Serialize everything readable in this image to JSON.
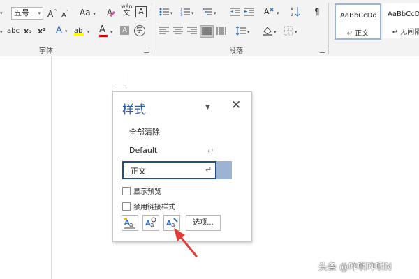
{
  "ribbon": {
    "font_group_label": "字体",
    "para_group_label": "段落",
    "font_size_value": "五号",
    "grow_font_label": "A",
    "shrink_font_label": "A",
    "change_case_label": "Aa",
    "phonetic_label": "wén",
    "border_char_label": "A",
    "strike_label": "abc",
    "subscript_label": "x₂",
    "superscript_label": "x²",
    "text_effect_label": "A",
    "font_color_label": "A",
    "char_shading_label": "A",
    "enclose_char_label": "字",
    "style_gallery": [
      {
        "sample": "AaBbCcDd",
        "name": "↵ 正文",
        "active": true
      },
      {
        "sample": "AaBbCcDc",
        "name": "↵ 无间隔",
        "active": false
      }
    ]
  },
  "styles_pane": {
    "title": "样式",
    "clear_all": "全部清除",
    "default_style": "Default",
    "current_style": "正文",
    "para_mark": "↵",
    "show_preview_label": "显示预览",
    "disable_linked_label": "禁用链接样式",
    "options_button_label": "选项..."
  },
  "watermark": "头条 @咋啊咋啊N",
  "colors": {
    "title_blue": "#2e5ea8",
    "selected_border": "#234f8e",
    "selected_side": "#9db3d4",
    "arrow_red": "#e03c3c",
    "font_color_bar": "#e00000"
  }
}
